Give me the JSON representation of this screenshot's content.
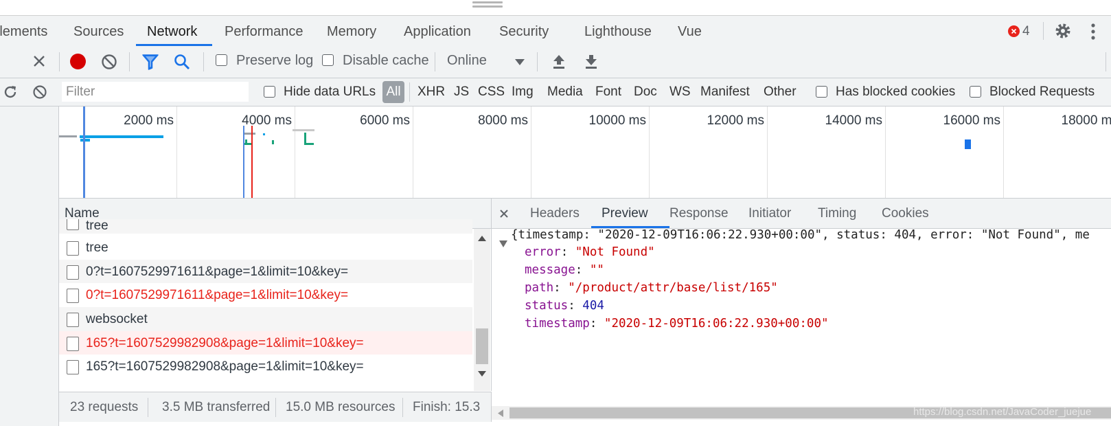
{
  "tabs": [
    "Elements",
    "Sources",
    "Network",
    "Performance",
    "Memory",
    "Application",
    "Security",
    "Lighthouse",
    "Vue"
  ],
  "error_count": "4",
  "toolbar": {
    "preserve_log": "Preserve log",
    "disable_cache": "Disable cache",
    "throttling": "Online"
  },
  "filterbar": {
    "placeholder": "Filter",
    "hide_data_urls": "Hide data URLs",
    "types": [
      "All",
      "XHR",
      "JS",
      "CSS",
      "Img",
      "Media",
      "Font",
      "Doc",
      "WS",
      "Manifest",
      "Other"
    ],
    "has_blocked_cookies": "Has blocked cookies",
    "blocked_requests": "Blocked Requests"
  },
  "overview": {
    "ticks": [
      "2000 ms",
      "4000 ms",
      "6000 ms",
      "8000 ms",
      "10000 ms",
      "12000 ms",
      "14000 ms",
      "16000 ms",
      "18000 ms"
    ]
  },
  "requests": {
    "column_name": "Name",
    "rows": [
      {
        "name": "tree",
        "error": false
      },
      {
        "name": "tree",
        "error": false
      },
      {
        "name": "0?t=1607529971611&page=1&limit=10&key=",
        "error": false
      },
      {
        "name": "0?t=1607529971611&page=1&limit=10&key=",
        "error": true
      },
      {
        "name": "websocket",
        "error": false
      },
      {
        "name": "165?t=1607529982908&page=1&limit=10&key=",
        "error": true
      },
      {
        "name": "165?t=1607529982908&page=1&limit=10&key=",
        "error": false
      }
    ]
  },
  "statusbar": {
    "requests": "23 requests",
    "transferred": "3.5 MB transferred",
    "resources": "15.0 MB resources",
    "finish": "Finish: 15.3"
  },
  "detail": {
    "tabs": [
      "Headers",
      "Preview",
      "Response",
      "Initiator",
      "Timing",
      "Cookies"
    ],
    "active_tab": "Preview",
    "preview": {
      "summary": "{timestamp: \"2020-12-09T16:06:22.930+00:00\", status: 404, error: \"Not Found\", me",
      "fields": [
        {
          "key": "error",
          "value": "\"Not Found\"",
          "type": "string"
        },
        {
          "key": "message",
          "value": "\"\"",
          "type": "string"
        },
        {
          "key": "path",
          "value": "\"/product/attr/base/list/165\"",
          "type": "string"
        },
        {
          "key": "status",
          "value": "404",
          "type": "number"
        },
        {
          "key": "timestamp",
          "value": "\"2020-12-09T16:06:22.930+00:00\"",
          "type": "string"
        }
      ]
    }
  },
  "watermark": "https://blog.csdn.net/JavaCoder_juejue",
  "colors": {
    "accent": "#1a73e8",
    "record": "#d50000",
    "error_text": "#e8231b",
    "error_row_bg": "#fff0f0",
    "json_key": "#881391",
    "json_string": "#c80000",
    "json_number": "#1a1aa6"
  }
}
